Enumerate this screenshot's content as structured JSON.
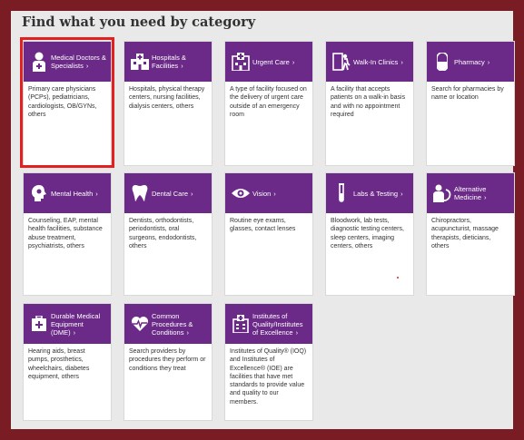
{
  "header": {
    "title": "Find what you need by category"
  },
  "accent_color": "#6b2a87",
  "highlight_color": "#e41f1f",
  "categories": [
    {
      "title": "Medical Doctors & Specialists",
      "icon": "doctor-icon",
      "description": "Primary care physicians (PCPs), pediatricians, cardiologists, OB/GYNs, others"
    },
    {
      "title": "Hospitals & Facilities",
      "icon": "hospital-icon",
      "description": "Hospitals, physical therapy centers, nursing facilities, dialysis centers, others"
    },
    {
      "title": "Urgent Care",
      "icon": "urgent-care-icon",
      "description": "A type of facility focused on the delivery of urgent care outside of an emergency room"
    },
    {
      "title": "Walk-In Clinics",
      "icon": "walk-in-icon",
      "description": "A facility that accepts patients on a walk-in basis and with no appointment required"
    },
    {
      "title": "Pharmacy",
      "icon": "pharmacy-icon",
      "description": "Search for pharmacies by name or location"
    },
    {
      "title": "Mental Health",
      "icon": "mental-health-icon",
      "description": "Counseling, EAP, mental health facilities, substance abuse treatment, psychiatrists, others"
    },
    {
      "title": "Dental Care",
      "icon": "tooth-icon",
      "description": "Dentists, orthodontists, periodontists, oral surgeons, endodontists, others"
    },
    {
      "title": "Vision",
      "icon": "eye-icon",
      "description": "Routine eye exams, glasses, contact lenses"
    },
    {
      "title": "Labs & Testing",
      "icon": "lab-icon",
      "description": "Bloodwork, lab tests, diagnostic testing centers, sleep centers, imaging centers, others"
    },
    {
      "title": "Alternative Medicine",
      "icon": "alternative-medicine-icon",
      "description": "Chiropractors, acupuncturist, massage therapists, dieticians, others"
    },
    {
      "title": "Durable Medical Equipment (DME)",
      "icon": "dme-icon",
      "description": "Hearing aids, breast pumps, prosthetics, wheelchairs, diabetes equipment, others"
    },
    {
      "title": "Common Procedures & Conditions",
      "icon": "heartbeat-icon",
      "description": "Search providers by procedures they perform or conditions they treat"
    },
    {
      "title": "Institutes of Quality/Institutes of Excellence",
      "icon": "institute-icon",
      "description": "Institutes of Quality® (IOQ) and Institutes of Excellence® (IOE) are facilities that have met standards to provide value and quality to our members."
    }
  ]
}
